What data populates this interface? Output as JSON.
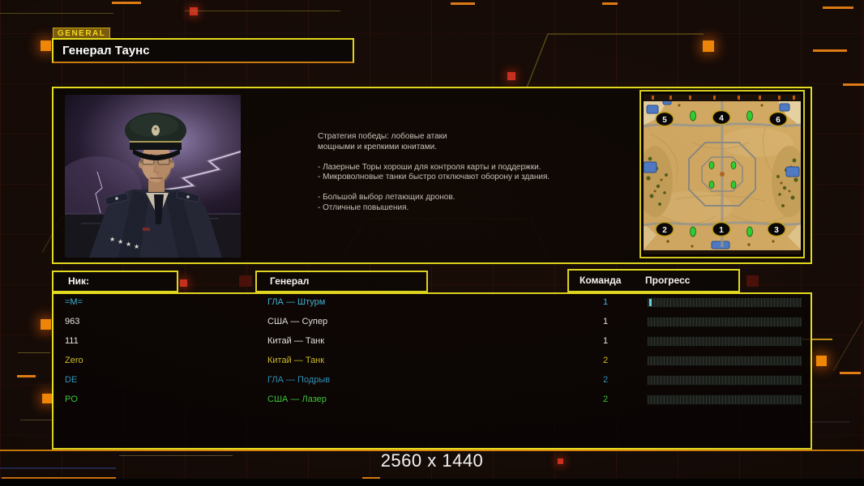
{
  "header": {
    "tab_label": "GENERAL",
    "general_name": "Генерал Таунс"
  },
  "briefing": {
    "lines": [
      "Стратегия победы: лобовые атаки",
      "мощными и крепкими юнитами.",
      "",
      "- Лазерные Торы хороши для контроля карты и поддержки.",
      "- Микроволновые танки быстро отключают оборону и здания.",
      "",
      "- Большой выбор летающих дронов.",
      "- Отличные повышения."
    ]
  },
  "minimap": {
    "spawn_numbers": [
      "1",
      "2",
      "3",
      "4",
      "5",
      "6"
    ]
  },
  "lobby": {
    "headers": {
      "nick": "Ник:",
      "general": "Генерал",
      "team": "Команда",
      "progress": "Прогресс"
    },
    "rows": [
      {
        "nick": "=M=",
        "general": "ГЛА — Штурм",
        "team": "1",
        "color": "#41b5d9",
        "has_cursor": true
      },
      {
        "nick": "963",
        "general": "США — Супер",
        "team": "1",
        "color": "#e8e8e8",
        "has_cursor": false
      },
      {
        "nick": "111",
        "general": "Китай — Танк",
        "team": "1",
        "color": "#e8e8e8",
        "has_cursor": false
      },
      {
        "nick": "Zero",
        "general": "Китай — Танк",
        "team": "2",
        "color": "#cdc02b",
        "has_cursor": false
      },
      {
        "nick": "DE",
        "general": "ГЛА — Подрыв",
        "team": "2",
        "color": "#2f93b8",
        "has_cursor": false
      },
      {
        "nick": "PO",
        "general": "США — Лазер",
        "team": "2",
        "color": "#3dc83d",
        "has_cursor": false
      }
    ]
  },
  "footer": {
    "resolution_label": "2560 x 1440"
  },
  "colors": {
    "panel_border_yellow": "#e8df1f",
    "accent_orange": "#f08708",
    "background": "#150b07",
    "text_white": "#ffffff",
    "player_cyan": "#41b5d9",
    "player_yellow": "#cdc02b",
    "player_green": "#3dc83d",
    "progress_cursor_cyan": "#62d9e8"
  }
}
